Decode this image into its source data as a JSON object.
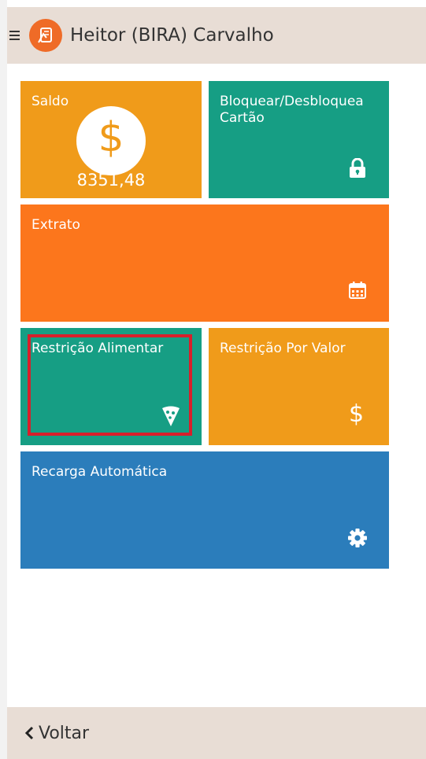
{
  "header": {
    "title": "Heitor (BIRA) Carvalho"
  },
  "tiles": {
    "saldo": {
      "label": "Saldo",
      "value": "8351,48",
      "symbol": "$"
    },
    "bloquear": {
      "label_line1": "Bloquear/Desbloquea",
      "label_line2": "Cartão"
    },
    "extrato": {
      "label": "Extrato"
    },
    "restricao_alimentar": {
      "label": "Restrição Alimentar"
    },
    "restricao_valor": {
      "label": "Restrição Por Valor",
      "symbol": "$"
    },
    "recarga": {
      "label": "Recarga Automática"
    }
  },
  "footer": {
    "back_label": "Voltar"
  },
  "colors": {
    "header_bg": "#e8ddd5",
    "orange_light": "#f09b1a",
    "teal": "#169e84",
    "orange": "#fc761c",
    "blue": "#2b7dbb",
    "highlight": "#d71f2b"
  },
  "icons": [
    "menu-icon",
    "app-logo-icon",
    "dollar-icon",
    "lock-icon",
    "calendar-icon",
    "pizza-icon",
    "gear-icon",
    "chevron-left-icon"
  ]
}
